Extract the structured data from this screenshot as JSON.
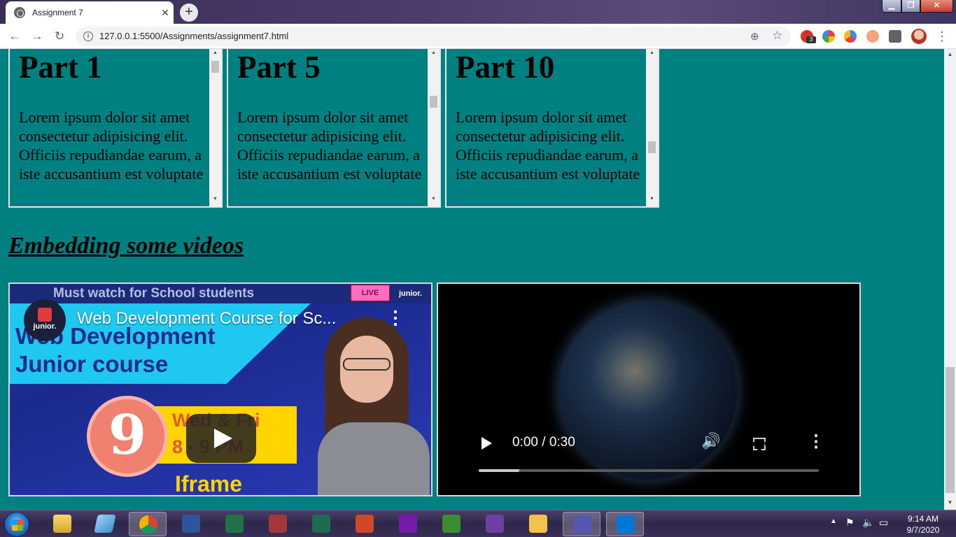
{
  "browser": {
    "tab_title": "Assignment 7",
    "tab_close": "✕",
    "new_tab": "+",
    "url": "127.0.0.1:5500/Assignments/assignment7.html",
    "extension_badge": "3"
  },
  "parts": [
    {
      "title": "Part 1",
      "text": "Lorem ipsum dolor sit amet consectetur adipisicing elit. Officiis repudiandae earum, a iste accusantium est voluptate"
    },
    {
      "title": "Part 5",
      "text": "Lorem ipsum dolor sit amet consectetur adipisicing elit. Officiis repudiandae earum, a iste accusantium est voluptate"
    },
    {
      "title": "Part 10",
      "text": "Lorem ipsum dolor sit amet consectetur adipisicing elit. Officiis repudiandae earum, a iste accusantium est voluptate"
    }
  ],
  "section_heading": "Embedding some videos",
  "youtube": {
    "title": "Web Development Course for Sc...",
    "thumb_banner": "Must watch for School students",
    "thumb_line1": "Web Development",
    "thumb_line2": "Junior course",
    "thumb_number": "9",
    "thumb_days": "Wed & Fri",
    "thumb_time": "8 - 9 PM",
    "thumb_word": "Iframe",
    "live_label": "LIVE",
    "channel_tag": "junior.",
    "channel_avatar": "junior."
  },
  "video": {
    "time": "0:00 / 0:30",
    "progress": 0.12
  },
  "clock": {
    "time": "9:14 AM",
    "date": "9/7/2020"
  },
  "colors": {
    "page_background": "#008080",
    "title_bar": "#3a2e57"
  }
}
